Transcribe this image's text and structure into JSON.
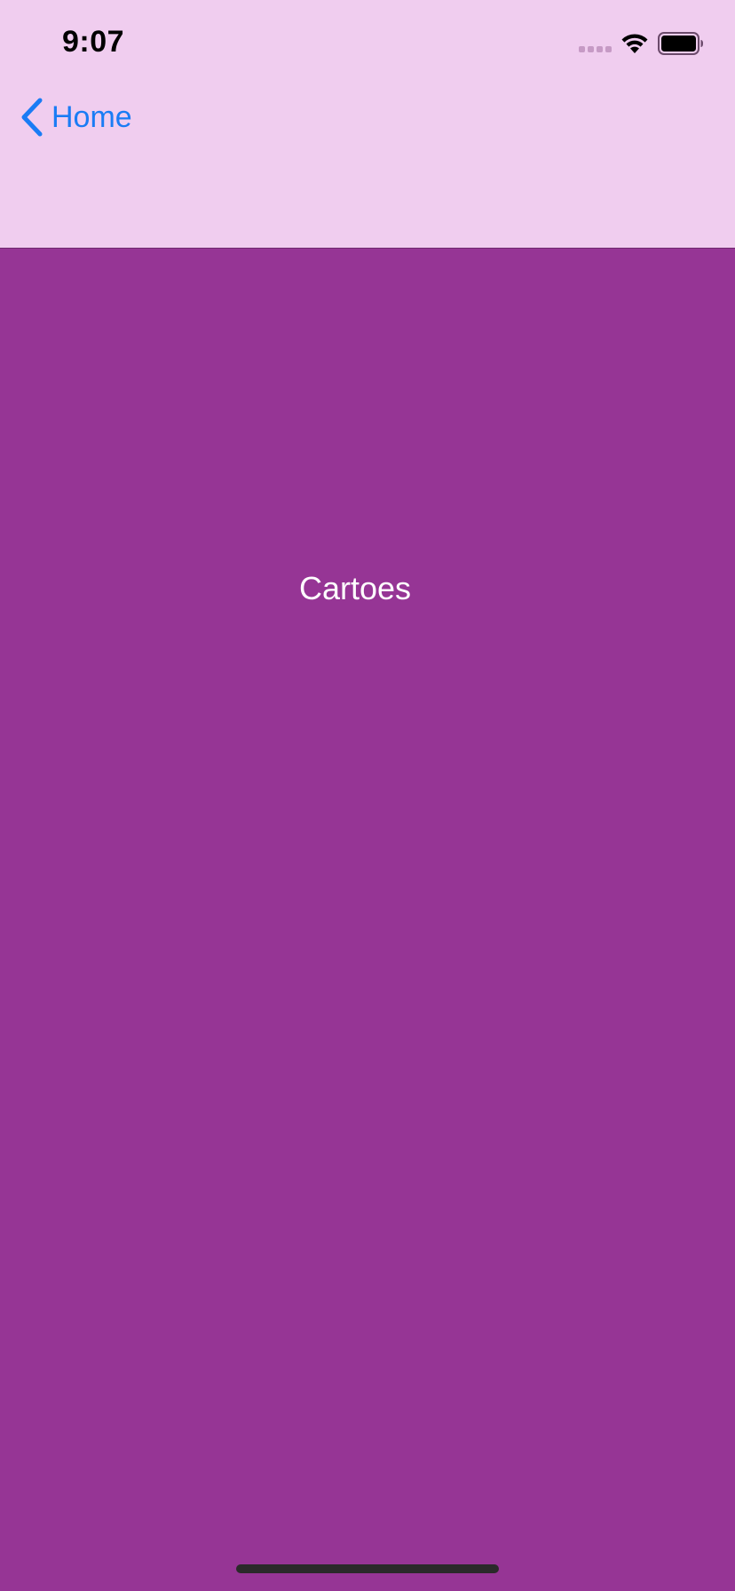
{
  "status_bar": {
    "time": "9:07",
    "signal_icon": "cellular-signal-icon",
    "wifi_icon": "wifi-icon",
    "battery_icon": "battery-icon"
  },
  "nav": {
    "back_label": "Home",
    "back_icon": "chevron-left-icon"
  },
  "content": {
    "label": "Cartoes"
  },
  "colors": {
    "header_bg": "#f0cdef",
    "content_bg": "#963595",
    "accent": "#1a7cf5",
    "label_text": "#ffffff"
  }
}
